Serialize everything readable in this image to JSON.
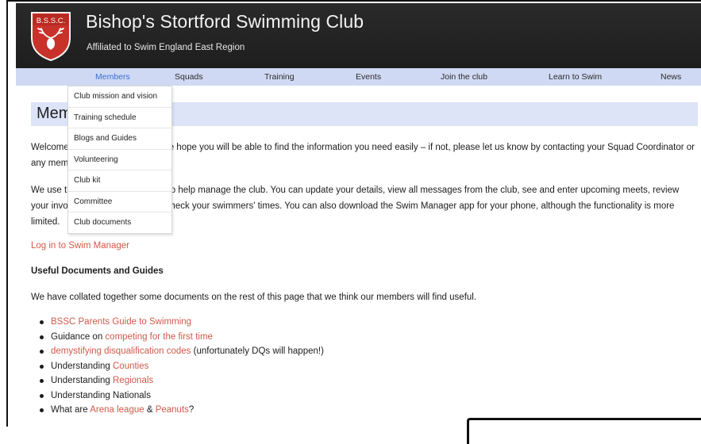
{
  "header": {
    "logo_text": "B.S.S.C.",
    "title": "Bishop's Stortford Swimming Club",
    "subtitle": "Affiliated to Swim England East Region"
  },
  "nav": {
    "items": [
      {
        "label": "Members",
        "active": true
      },
      {
        "label": "Squads"
      },
      {
        "label": "Training"
      },
      {
        "label": "Events"
      },
      {
        "label": "Join the club"
      },
      {
        "label": "Learn to Swim"
      },
      {
        "label": "News"
      }
    ]
  },
  "dropdown": {
    "items": [
      "Club mission and vision",
      "Training schedule",
      "Blogs and Guides",
      "Volunteering",
      "Club kit",
      "Committee",
      "Club documents"
    ]
  },
  "page": {
    "title_visible": "Meml"
  },
  "content": {
    "intro": {
      "line1_start": "Welcome",
      "line1_end": "e hope you will be able to find the information you need easily – if not, please let us know by contacting your Squad Coordinator or",
      "line2": "any mem"
    },
    "swim_manager": {
      "line1_start": "We use th",
      "line1_end": "to help manage the club.  You can update your details, view all messages from the club, see and enter upcoming meets, review",
      "line2_start": "your invo",
      "line2_end": "check your swimmers' times.  You can also download the Swim Manager app for your phone, although the functionality is more",
      "line3": "limited."
    },
    "login_link": "Log in to Swim Manager",
    "useful_heading": "Useful Documents and Guides",
    "collated_text": "We have collated together some documents on the rest of this page that we think our members will find useful.",
    "list": {
      "item1_link": "BSSC Parents Guide to Swimming",
      "item2_text": "Guidance on ",
      "item2_link": "competing for the first time",
      "item3_link": "demystifying disqualification codes",
      "item3_text": " (unfortunately DQs will happen!)",
      "item4_text": "Understanding ",
      "item4_link": "Counties",
      "item5_text": "Understanding ",
      "item5_link": "Regionals",
      "item6_text": "Understanding Nationals",
      "item7_text": "What are ",
      "item7_link1": "Arena league",
      "item7_mid": " & ",
      "item7_link2": "Peanuts",
      "item7_end": "?"
    }
  },
  "colors": {
    "header_bg": "#232323",
    "nav_bg": "#cfd9f3",
    "heading_bar_bg": "#dde4f8",
    "link": "#d0594a",
    "active_nav": "#3b6fd4",
    "logo_red": "#c8322a"
  }
}
